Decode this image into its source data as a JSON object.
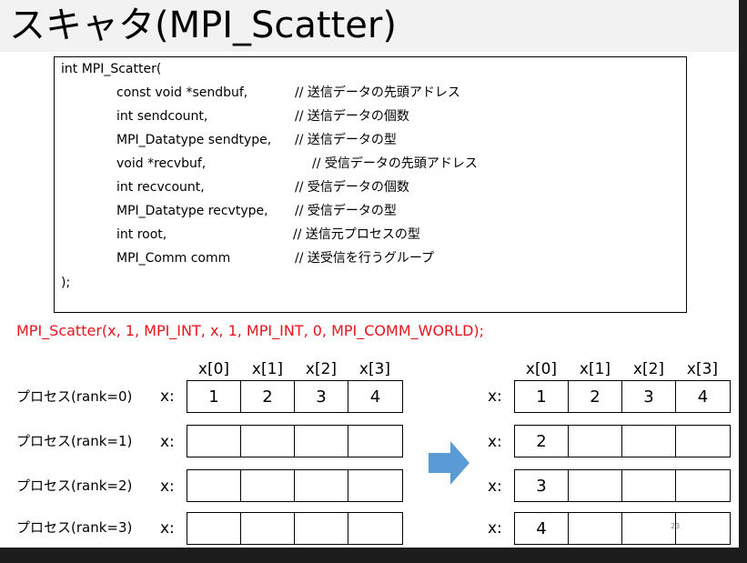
{
  "title": {
    "main": "スキャタ",
    "sub": "(MPI_Scatter)"
  },
  "signature": {
    "open": "int MPI_Scatter(",
    "params": [
      {
        "decl": "const void *sendbuf,",
        "comment": "//  送信データの先頭アドレス"
      },
      {
        "decl": "int sendcount,",
        "comment": "//  送信データの個数"
      },
      {
        "decl": "MPI_Datatype sendtype,",
        "comment": "//  送信データの型"
      },
      {
        "decl": "void *recvbuf,",
        "comment": "//  受信データの先頭アドレス"
      },
      {
        "decl": "int recvcount,",
        "comment": "//  受信データの個数"
      },
      {
        "decl": "MPI_Datatype recvtype,",
        "comment": "//  受信データの型"
      },
      {
        "decl": "int root,",
        "comment": "//  送信元プロセスの型"
      },
      {
        "decl": "MPI_Comm comm",
        "comment": "//  送受信を行うグループ"
      }
    ],
    "close": ");"
  },
  "call_example": "MPI_Scatter(x, 1, MPI_INT, x, 1, MPI_INT, 0, MPI_COMM_WORLD);",
  "indices": [
    "x[0]",
    "x[1]",
    "x[2]",
    "x[3]"
  ],
  "x_label": "x:",
  "before": [
    {
      "label": "プロセス(rank=0)",
      "cells": [
        "1",
        "2",
        "3",
        "4"
      ]
    },
    {
      "label": "プロセス(rank=1)",
      "cells": [
        "",
        "",
        "",
        ""
      ]
    },
    {
      "label": "プロセス(rank=2)",
      "cells": [
        "",
        "",
        "",
        ""
      ]
    },
    {
      "label": "プロセス(rank=3)",
      "cells": [
        "",
        "",
        "",
        ""
      ]
    }
  ],
  "after": [
    {
      "cells": [
        "1",
        "2",
        "3",
        "4"
      ]
    },
    {
      "cells": [
        "2",
        "",
        "",
        ""
      ]
    },
    {
      "cells": [
        "3",
        "",
        "",
        ""
      ]
    },
    {
      "cells": [
        "4",
        "",
        "",
        ""
      ]
    }
  ],
  "arrow_color": "#5b9bd5",
  "page_number": "23"
}
